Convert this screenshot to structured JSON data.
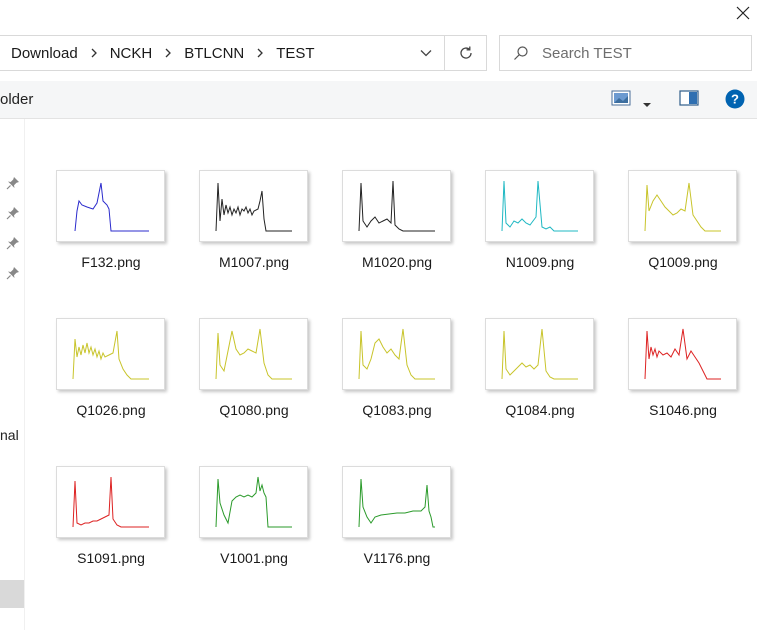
{
  "window": {
    "close_icon": "close-icon"
  },
  "address_bar": {
    "breadcrumbs": [
      "Download",
      "NCKH",
      "BTLCNN",
      "TEST"
    ],
    "chevron_icon": "chevron-right-icon",
    "dropdown_icon": "chevron-down-icon",
    "refresh_icon": "refresh-icon"
  },
  "search": {
    "placeholder": "Search TEST",
    "icon": "search-icon"
  },
  "ribbon": {
    "partial_label": "older",
    "view_icon": "change-view-icon",
    "preview_pane_icon": "preview-pane-icon",
    "help_icon": "help-icon"
  },
  "nav_pane": {
    "partial_text": "nal",
    "pin_icon": "pin-icon"
  },
  "files": [
    {
      "name": "F132.png",
      "color": "#2b2bcc"
    },
    {
      "name": "M1007.png",
      "color": "#222222"
    },
    {
      "name": "M1020.png",
      "color": "#222222"
    },
    {
      "name": "N1009.png",
      "color": "#1fb8c3"
    },
    {
      "name": "Q1009.png",
      "color": "#c8c42a"
    },
    {
      "name": "Q1026.png",
      "color": "#c8c42a"
    },
    {
      "name": "Q1080.png",
      "color": "#c8c42a"
    },
    {
      "name": "Q1083.png",
      "color": "#c8c42a"
    },
    {
      "name": "Q1084.png",
      "color": "#c8c42a"
    },
    {
      "name": "S1046.png",
      "color": "#dd2222"
    },
    {
      "name": "S1091.png",
      "color": "#dd2222"
    },
    {
      "name": "V1001.png",
      "color": "#2a9a2a"
    },
    {
      "name": "V1176.png",
      "color": "#2a9a2a"
    }
  ],
  "colors": {
    "accent": "#0063b1",
    "selection": "#d9d9d9"
  }
}
